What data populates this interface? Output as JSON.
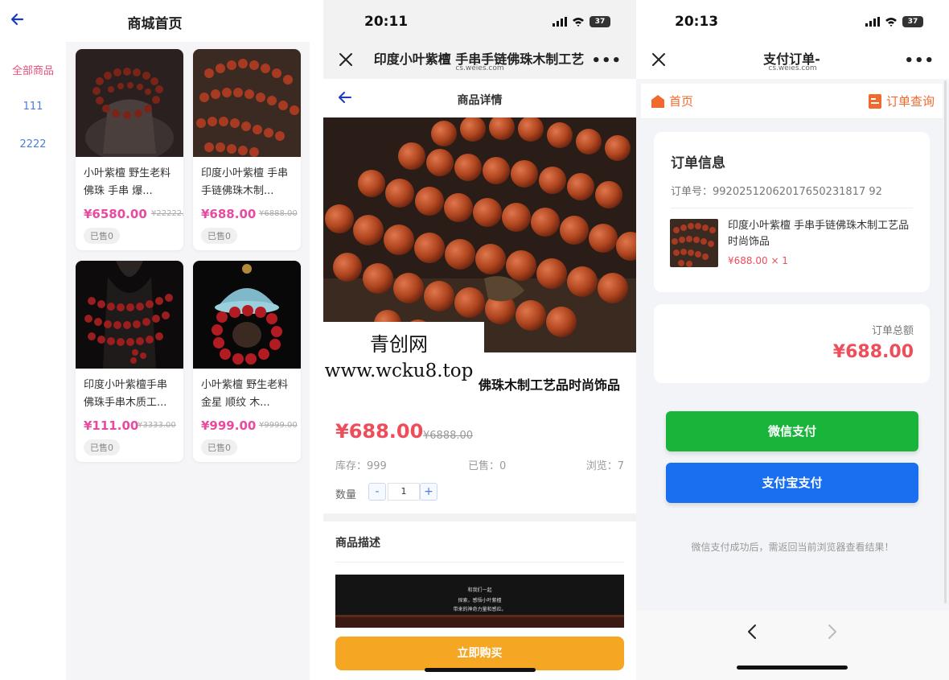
{
  "panel1": {
    "title": "商城首页",
    "sidebar": [
      {
        "label": "全部商品",
        "active": true
      },
      {
        "label": "111",
        "active": false
      },
      {
        "label": "2222",
        "active": false
      }
    ],
    "products": [
      {
        "name": "小叶紫檀 野生老料 佛珠 手串 爆...",
        "price": "¥6580.00",
        "old_price": "¥22222...",
        "sold": "已售0"
      },
      {
        "name": "印度小叶紫檀 手串手链佛珠木制...",
        "price": "¥688.00",
        "old_price": "¥6888.00",
        "sold": "已售0"
      },
      {
        "name": "印度小叶紫檀手串佛珠手串木质工...",
        "price": "¥111.00",
        "old_price": "¥3333.00",
        "sold": "已售0"
      },
      {
        "name": "小叶紫檀 野生老料金星 顺纹 木...",
        "price": "¥999.00",
        "old_price": "¥9999.00",
        "sold": "已售0"
      }
    ]
  },
  "panel2": {
    "status": {
      "time": "20:11",
      "battery": "37"
    },
    "browser": {
      "title": "印度小叶紫檀 手串手链佛珠木制工艺",
      "domain": "cs.weies.com"
    },
    "nav_title": "商品详情",
    "watermark": {
      "line1": "青创网",
      "line2": "www.wcku8.top"
    },
    "product_name": "佛珠木制工艺品时尚饰品",
    "price": "¥688.00",
    "old_price": "¥6888.00",
    "stock": "库存：999",
    "sold": "已售：0",
    "views": "浏览：7",
    "qty_label": "数量",
    "qty_minus": "-",
    "qty_value": "1",
    "qty_plus": "+",
    "desc_title": "商品描述",
    "banner": {
      "line1": "和我们一起",
      "line2": "探索，感悟小叶紫檀",
      "line3": "带来的神奇力量和感应。"
    },
    "buy_label": "立即购买"
  },
  "panel3": {
    "status": {
      "time": "20:13",
      "battery": "37"
    },
    "browser": {
      "title": "支付订单-",
      "domain": "cs.weies.com"
    },
    "home_label": "首页",
    "orders_label": "订单查询",
    "order_info_title": "订单信息",
    "order_no": "订单号：99202512062017650231817 92",
    "item_name": "印度小叶紫檀 手串手链佛珠木制工艺品时尚饰品",
    "item_price": "¥688.00 × 1",
    "total_label": "订单总额",
    "total_amount": "¥688.00",
    "wechat_pay": "微信支付",
    "alipay": "支付宝支付",
    "tip": "微信支付成功后，需返回当前浏览器查看结果！"
  },
  "colors": {
    "accent_pink": "#e84aa0",
    "price_red": "#ee4d5a",
    "orange": "#f06a2d",
    "buy_yellow": "#f5a623",
    "wechat_green": "#19b43a",
    "alipay_blue": "#1a6ff0"
  }
}
